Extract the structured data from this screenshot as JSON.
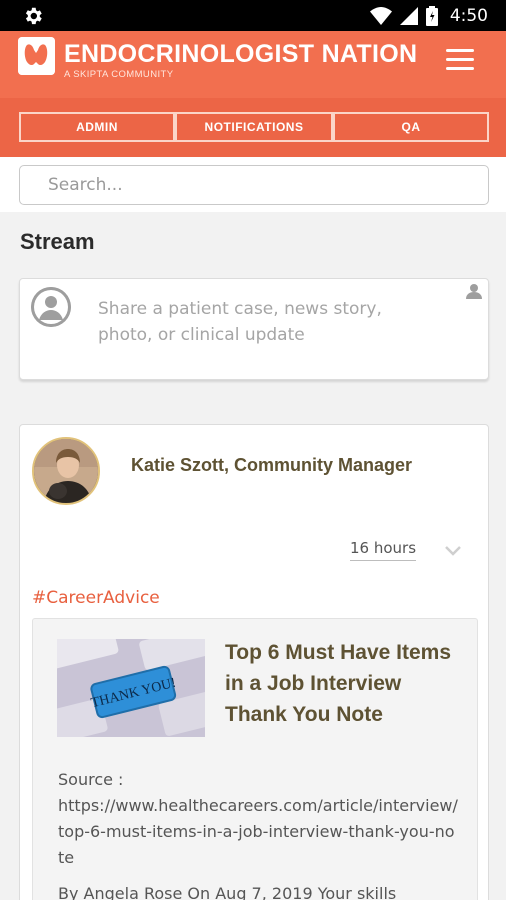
{
  "status_bar": {
    "time": "4:50"
  },
  "header": {
    "title": "ENDOCRINOLOGIST NATION",
    "subtitle": "A SKIPTA COMMUNITY",
    "brand_color": "#f26f4f"
  },
  "tabs": [
    {
      "label": "ADMIN"
    },
    {
      "label": "NOTIFICATIONS"
    },
    {
      "label": "QA"
    }
  ],
  "search": {
    "placeholder": "Search..."
  },
  "stream": {
    "title": "Stream",
    "composer_placeholder": "Share a patient case, news story, photo, or clinical update"
  },
  "post": {
    "author": "Katie Szott, Community Manager",
    "time": "16 hours",
    "tag": "#CareerAdvice",
    "article": {
      "title": "Top 6 Must Have Items in a Job Interview Thank You Note",
      "thumbnail_text": "THANK YOU!",
      "source_label": "Source :",
      "source_url": "https://www.healthecareers.com/article/interview/top-6-must-items-in-a-job-interview-thank-you-note",
      "byline": "By Angela Rose On Aug 7, 2019 Your skills"
    }
  },
  "colors": {
    "accent": "#f26f4f",
    "tag": "#e8603f",
    "author": "#5e5233"
  }
}
